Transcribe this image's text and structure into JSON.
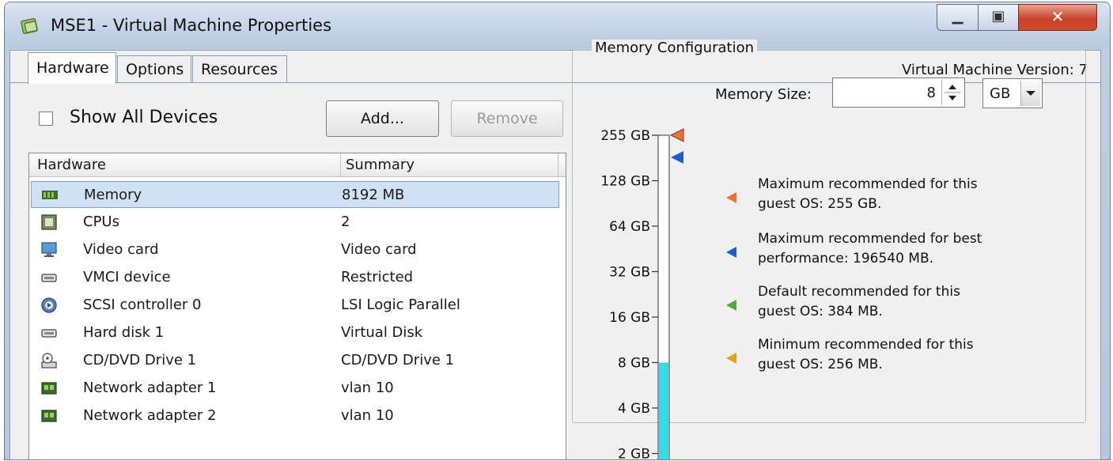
{
  "window": {
    "title": "MSE1 - Virtual Machine Properties",
    "version_label": "Virtual Machine Version: 7"
  },
  "tabs": [
    {
      "label": "Hardware",
      "active": true
    },
    {
      "label": "Options",
      "active": false
    },
    {
      "label": "Resources",
      "active": false
    }
  ],
  "devices": {
    "show_all_label": "Show All Devices",
    "show_all_checked": false,
    "add_label": "Add...",
    "remove_label": "Remove"
  },
  "hardware_table": {
    "columns": [
      "Hardware",
      "Summary"
    ],
    "rows": [
      {
        "name": "Memory",
        "summary": "8192 MB",
        "icon": "memory-icon",
        "selected": true
      },
      {
        "name": "CPUs",
        "summary": "2",
        "icon": "cpu-icon"
      },
      {
        "name": "Video card",
        "summary": "Video card",
        "icon": "monitor-icon"
      },
      {
        "name": "VMCI device",
        "summary": "Restricted",
        "icon": "device-icon"
      },
      {
        "name": "SCSI controller 0",
        "summary": "LSI Logic Parallel",
        "icon": "scsi-icon"
      },
      {
        "name": "Hard disk 1",
        "summary": "Virtual Disk",
        "icon": "disk-icon"
      },
      {
        "name": "CD/DVD Drive 1",
        "summary": "CD/DVD Drive 1",
        "icon": "cd-drive-icon"
      },
      {
        "name": "Network adapter 1",
        "summary": "vlan 10",
        "icon": "network-icon"
      },
      {
        "name": "Network adapter 2",
        "summary": "vlan 10",
        "icon": "network-icon"
      }
    ]
  },
  "memory_config": {
    "group_title": "Memory Configuration",
    "size_label": "Memory Size:",
    "size_value": "8",
    "unit_value": "GB",
    "scale_labels": [
      "255 GB",
      "128 GB",
      "64 GB",
      "32 GB",
      "16 GB",
      "8 GB",
      "4 GB",
      "2 GB"
    ],
    "current_gb": 8,
    "legend": [
      {
        "line1": "Maximum recommended for this",
        "line2": "guest OS: 255 GB.",
        "color": "#e8743b"
      },
      {
        "line1": "Maximum recommended for best",
        "line2": "performance: 196540 MB.",
        "color": "#1e5fc7"
      },
      {
        "line1": "Default recommended for this",
        "line2": "guest OS: 384 MB.",
        "color": "#57a83c"
      },
      {
        "line1": "Minimum recommended for this",
        "line2": "guest OS: 256 MB.",
        "color": "#e3a21a"
      }
    ],
    "marker_colors": {
      "fill": "#37d9e8",
      "max_os": "#e8743b",
      "max_perf": "#1e5fc7"
    }
  }
}
